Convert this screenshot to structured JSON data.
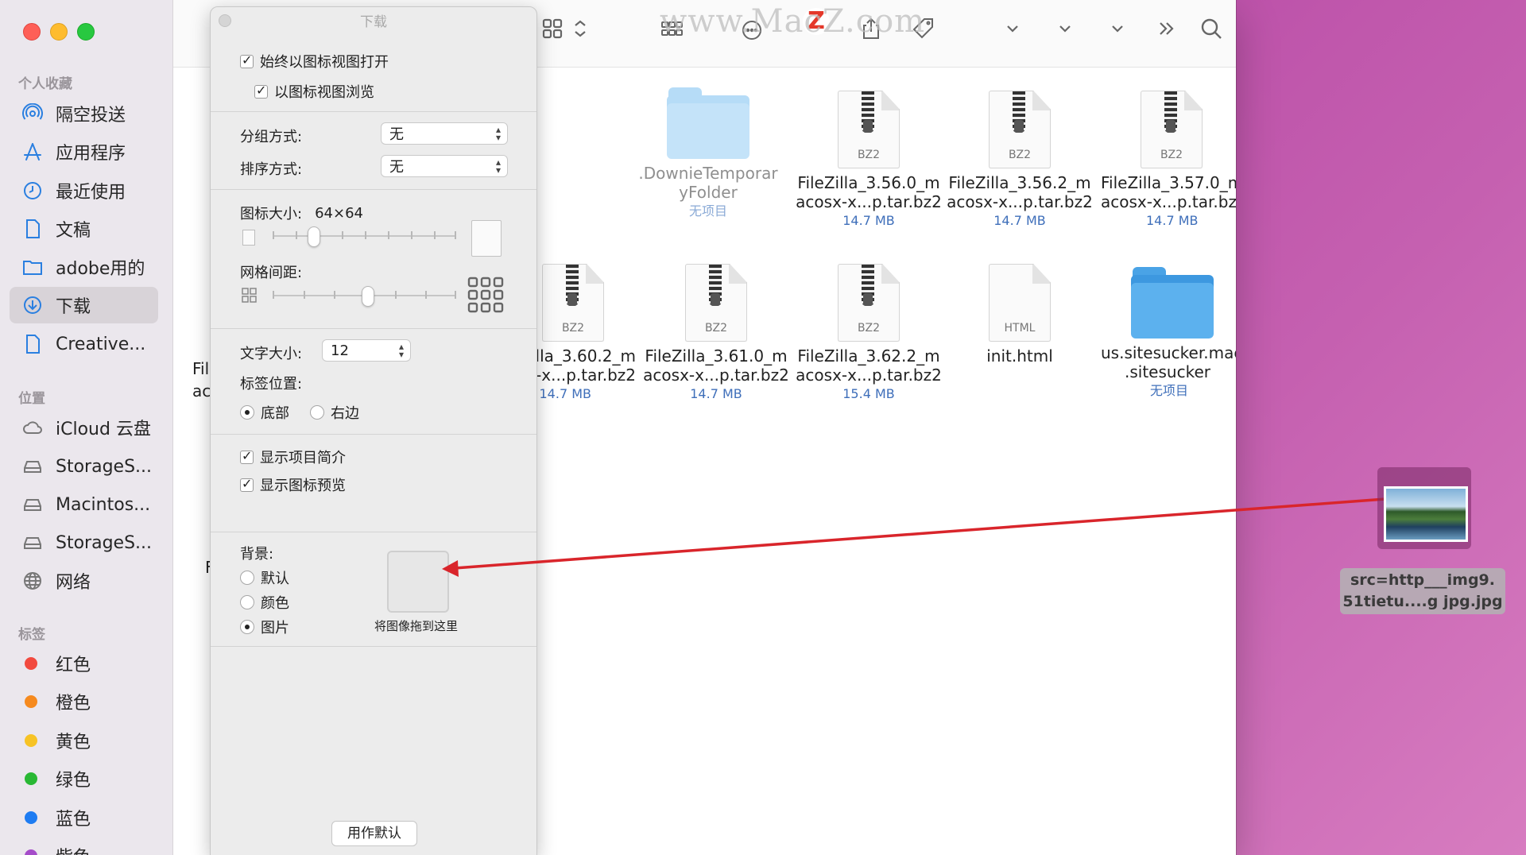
{
  "sidebar": {
    "favorites_header": "个人收藏",
    "favorites": [
      {
        "label": "隔空投送",
        "icon": "airdrop-icon"
      },
      {
        "label": "应用程序",
        "icon": "applications-icon"
      },
      {
        "label": "最近使用",
        "icon": "recents-icon"
      },
      {
        "label": "文稿",
        "icon": "document-icon"
      },
      {
        "label": "adobe用的",
        "icon": "folder-icon"
      },
      {
        "label": "下载",
        "icon": "downloads-icon",
        "selected": true
      },
      {
        "label": "Creative...",
        "icon": "document-icon"
      }
    ],
    "locations_header": "位置",
    "locations": [
      {
        "label": "iCloud 云盘",
        "icon": "cloud-icon"
      },
      {
        "label": "StorageS...",
        "icon": "drive-icon"
      },
      {
        "label": "Macintos...",
        "icon": "drive-icon"
      },
      {
        "label": "StorageS...",
        "icon": "drive-icon"
      },
      {
        "label": "网络",
        "icon": "network-icon"
      }
    ],
    "tags_header": "标签",
    "tags": [
      {
        "label": "红色",
        "color": "#f24a3f"
      },
      {
        "label": "橙色",
        "color": "#f68a1e"
      },
      {
        "label": "黄色",
        "color": "#f7c325"
      },
      {
        "label": "绿色",
        "color": "#29b834"
      },
      {
        "label": "蓝色",
        "color": "#1e7cf2"
      },
      {
        "label": "紫色",
        "color": "#a54cc9"
      }
    ]
  },
  "toolbar": {
    "watermark": "www.MacZ.com",
    "watermark_logo": "Z"
  },
  "files": [
    {
      "name_line1": ".DownieTemporar",
      "name_line2": "yFolder",
      "size": "无项目",
      "kind": "folder-pale"
    },
    {
      "name_line1": "FileZilla_3.56.0_m",
      "name_line2": "acosx-x...p.tar.bz2",
      "size": "14.7 MB",
      "kind": "bz2",
      "ext": "BZ2"
    },
    {
      "name_line1": "FileZilla_3.56.2_m",
      "name_line2": "acosx-x...p.tar.bz2",
      "size": "14.7 MB",
      "kind": "bz2",
      "ext": "BZ2"
    },
    {
      "name_line1": "FileZilla_3.57.0_m",
      "name_line2": "acosx-x...p.tar.bz2",
      "size": "14.7 MB",
      "kind": "bz2",
      "ext": "BZ2"
    },
    {
      "name_line1": "lla_3.60.2_m",
      "name_line2": "-x...p.tar.bz2",
      "size": "14.7 MB",
      "kind": "bz2",
      "ext": "BZ2"
    },
    {
      "name_line1": "FileZilla_3.61.0_m",
      "name_line2": "acosx-x...p.tar.bz2",
      "size": "14.7 MB",
      "kind": "bz2",
      "ext": "BZ2"
    },
    {
      "name_line1": "FileZilla_3.62.2_m",
      "name_line2": "acosx-x...p.tar.bz2",
      "size": "15.4 MB",
      "kind": "bz2",
      "ext": "BZ2"
    },
    {
      "name_line1": "init.html",
      "name_line2": "",
      "size": "",
      "kind": "html",
      "ext": "HTML"
    },
    {
      "name_line1": "us.sitesucker.mac",
      "name_line2": ".sitesucker",
      "size": "无项目",
      "kind": "folder"
    }
  ],
  "clipped_left": {
    "a": "Fil",
    "b": "ac",
    "c": "F"
  },
  "panel": {
    "title": "下载",
    "always_open_icon_view": "始终以图标视图打开",
    "browse_icon_view": "以图标视图浏览",
    "group_by_label": "分组方式:",
    "group_by_value": "无",
    "sort_by_label": "排序方式:",
    "sort_by_value": "无",
    "icon_size_label": "图标大小:",
    "icon_size_value": "64×64",
    "grid_spacing_label": "网格间距:",
    "text_size_label": "文字大小:",
    "text_size_value": "12",
    "label_position_label": "标签位置:",
    "label_bottom": "底部",
    "label_right": "右边",
    "show_item_info": "显示项目简介",
    "show_icon_preview": "显示图标预览",
    "background_label": "背景:",
    "bg_default": "默认",
    "bg_color": "颜色",
    "bg_picture": "图片",
    "drop_hint": "将图像拖到这里",
    "use_as_defaults": "用作默认"
  },
  "dragged_file": {
    "line1": "src=http___img9.",
    "line2": "51tietu....g jpg.jpg"
  },
  "colors": {
    "arrow": "#d9252b",
    "desktop": "#c25aae"
  }
}
